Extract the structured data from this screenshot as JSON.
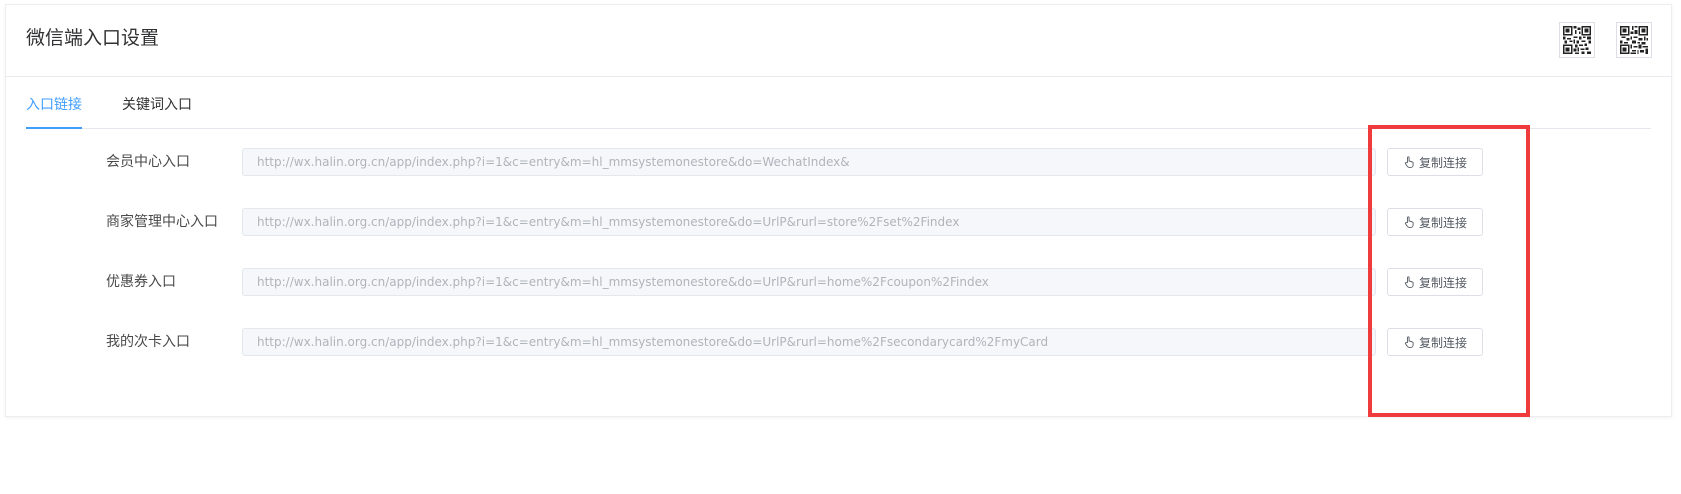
{
  "header": {
    "title": "微信端入口设置",
    "qr_icons": [
      "qr-code-icon",
      "qr-code-icon"
    ]
  },
  "tabs": [
    {
      "label": "入口链接",
      "active": true
    },
    {
      "label": "关键词入口",
      "active": false
    }
  ],
  "rows": [
    {
      "label": "会员中心入口",
      "url": "http://wx.halin.org.cn/app/index.php?i=1&c=entry&m=hl_mmsystemonestore&do=WechatIndex&",
      "button": "复制连接"
    },
    {
      "label": "商家管理中心入口",
      "url": "http://wx.halin.org.cn/app/index.php?i=1&c=entry&m=hl_mmsystemonestore&do=UrlP&rurl=store%2Fset%2Findex",
      "button": "复制连接"
    },
    {
      "label": "优惠券入口",
      "url": "http://wx.halin.org.cn/app/index.php?i=1&c=entry&m=hl_mmsystemonestore&do=UrlP&rurl=home%2Fcoupon%2Findex",
      "button": "复制连接"
    },
    {
      "label": "我的次卡入口",
      "url": "http://wx.halin.org.cn/app/index.php?i=1&c=entry&m=hl_mmsystemonestore&do=UrlP&rurl=home%2Fsecondarycard%2FmyCard",
      "button": "复制连接"
    }
  ],
  "icons": {
    "copy": "hand-pointer-icon"
  },
  "colors": {
    "accent": "#409eff",
    "highlight": "#ef3b3b",
    "input_bg": "#f5f7fa"
  }
}
